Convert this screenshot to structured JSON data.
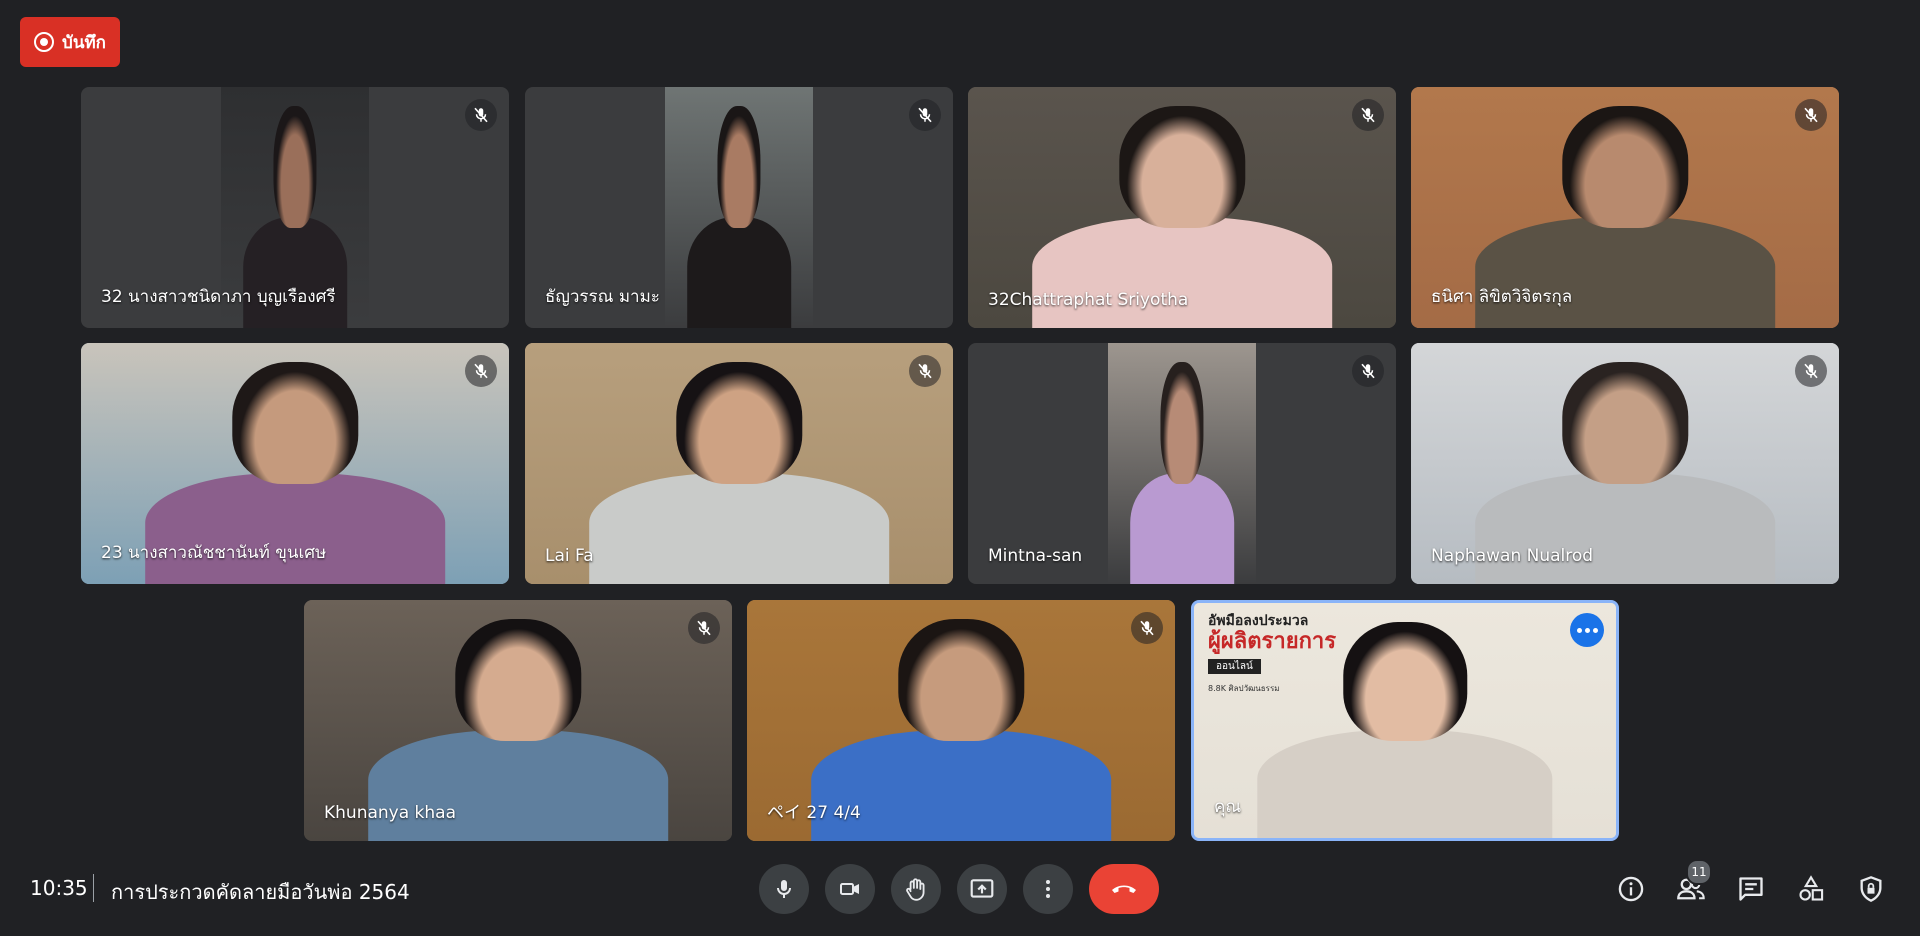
{
  "recording": {
    "label": "บันทึก",
    "icon": "record-icon"
  },
  "participants": [
    {
      "name": "32 นางสาวชนิดาภา บุญเรืองศรี",
      "muted": true,
      "layout": "portrait",
      "bg": "#3b3c3e",
      "video": "#2e2f31",
      "skin": "#9a6f5a",
      "hair": "#1b1718",
      "shirt": "#252024"
    },
    {
      "name": "ธัญวรรณ มามะ",
      "muted": true,
      "layout": "portrait",
      "bg": "#3b3c3e",
      "video": "#6f7574",
      "skin": "#a97b63",
      "hair": "#1a1616",
      "shirt": "#1d1a1b"
    },
    {
      "name": "32Chattraphat Sriyotha",
      "muted": true,
      "layout": "full",
      "bg": "#4c4840",
      "video": "#5a544d",
      "skin": "#d8b09a",
      "hair": "#1c1715",
      "shirt": "#e7c5c2"
    },
    {
      "name": "ธนิศา ลิขิตวิจิตรกุล",
      "muted": true,
      "layout": "full",
      "bg": "#a46b46",
      "video": "#b2784c",
      "skin": "#b88a6e",
      "hair": "#1b1614",
      "shirt": "#5a5245"
    },
    {
      "name": "23 นางสาวณัชชานันท์ ขุนเศษ",
      "muted": true,
      "layout": "full",
      "bg": "#7da0b5",
      "video": "#c9c4bb",
      "skin": "#c59a7d",
      "hair": "#1e1817",
      "shirt": "#8b5f8c"
    },
    {
      "name": "Lai Fa",
      "muted": true,
      "layout": "full",
      "bg": "#a88f6c",
      "video": "#b79f7d",
      "skin": "#cea283",
      "hair": "#161214",
      "shirt": "#c9cbc9"
    },
    {
      "name": "Mintna-san",
      "muted": true,
      "layout": "portrait",
      "bg": "#3b3c3e",
      "video": "#9d968f",
      "skin": "#b78b76",
      "hair": "#27201e",
      "shirt": "#b99ad1"
    },
    {
      "name": "Naphawan Nualrod",
      "muted": true,
      "layout": "full",
      "bg": "#b6bcc2",
      "video": "#d4d6d8",
      "skin": "#c49f86",
      "hair": "#2a2321",
      "shirt": "#b9bbbd"
    },
    {
      "name": "Khunanya khaa",
      "muted": true,
      "layout": "full",
      "bg": "#4a4540",
      "video": "#6c6258",
      "skin": "#d5ab8f",
      "hair": "#141112",
      "shirt": "#5f7f9e"
    },
    {
      "name": "ペイ 27 4/4",
      "muted": true,
      "layout": "full",
      "bg": "#9b6a32",
      "video": "#a9763a",
      "skin": "#c69b7d",
      "hair": "#1b1513",
      "shirt": "#3b6fc6"
    },
    {
      "name": "คุณ",
      "muted": false,
      "layout": "full",
      "self": true,
      "bg": "#e5e0d6",
      "video": "#ece7dd",
      "skin": "#e2bca3",
      "hair": "#151112",
      "shirt": "#d6cfc6"
    }
  ],
  "self_tile": {
    "poster_line1": "อัพมือลงประมวล",
    "poster_line2": "ผู้ผลิตรายการ",
    "poster_line3": "ออนไลน์",
    "poster_line4": "8.8K ศิลปวัฒนธรรม"
  },
  "bottom_bar": {
    "time": "10:35",
    "meeting_title": "การประกวดคัดลายมือวันพ่อ 2564",
    "participant_count": "11"
  },
  "colors": {
    "background": "#202124",
    "control": "#3c4043",
    "end_call": "#ea4335",
    "record": "#d93025",
    "accent": "#1a73e8"
  }
}
